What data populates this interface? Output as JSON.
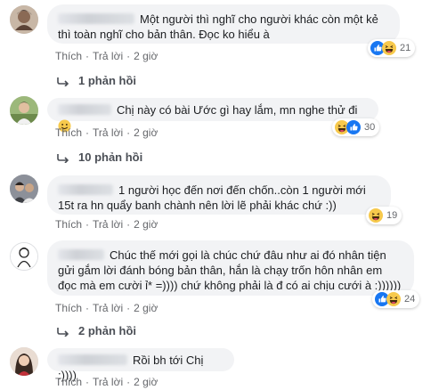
{
  "comments": [
    {
      "text": "Một người thì nghĩ cho người khác còn một kẻ thì toàn nghĩ cho bản thân. Đọc ko hiểu à",
      "like_label": "Thích",
      "reply_label": "Trả lời",
      "time": "2 giờ",
      "reaction_count": "21",
      "reactions": [
        "like-icon",
        "haha-icon"
      ],
      "replies_label": "1 phản hồi"
    },
    {
      "text": "Chị này có bài Ước gì hay lắm, mn nghe thử đi",
      "emoji": "smile-emoji",
      "like_label": "Thích",
      "reply_label": "Trả lời",
      "time": "2 giờ",
      "reaction_count": "30",
      "reactions": [
        "haha-icon",
        "like-icon"
      ],
      "replies_label": "10 phản hồi"
    },
    {
      "text": "1 người học đến nơi đến chốn..còn 1 người mới 15t ra hn quẩy banh chành nên lời lẽ phải khác chứ :))",
      "like_label": "Thích",
      "reply_label": "Trả lời",
      "time": "2 giờ",
      "reaction_count": "19",
      "reactions": [
        "haha-icon"
      ]
    },
    {
      "text": "Chúc thế mới gọi là chúc chứ đâu như ai đó nhân tiện gửi gắm lời đánh bóng bản thân, hắn là chạy trốn hôn nhân em đọc mà em cười ỉ* =)))) chứ không phải là đ có ai chịu cưới à :))))))",
      "like_label": "Thích",
      "reply_label": "Trả lời",
      "time": "2 giờ",
      "reaction_count": "24",
      "reactions": [
        "like-icon",
        "haha-icon"
      ],
      "replies_label": "2 phản hồi"
    },
    {
      "text": "Rồi bh tới Chị :))))",
      "like_label": "Thích",
      "reply_label": "Trả lời",
      "time": "2 giờ"
    }
  ],
  "colors": {
    "bubble_bg": "#f2f3f5",
    "meta_text": "#65676b",
    "like_blue": "#1877f2",
    "haha_yellow": "#f7c94c"
  }
}
